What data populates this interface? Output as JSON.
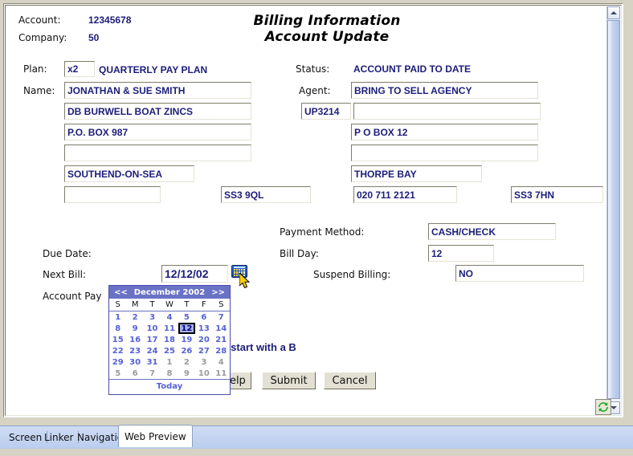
{
  "header": {
    "account_label": "Account:",
    "account_value": "12345678",
    "company_label": "Company:",
    "company_value": "50",
    "title_line1": "Billing Information",
    "title_line2": "Account Update"
  },
  "form": {
    "plan_label": "Plan:",
    "plan_code": "x2",
    "plan_description": "QUARTERLY PAY PLAN",
    "name_label": "Name:",
    "name_value": "JONATHAN & SUE SMITH",
    "left_address": [
      "DB BURWELL BOAT ZINCS",
      "P.O. BOX 987",
      "",
      "SOUTHEND-ON-SEA"
    ],
    "left_city_extra": "",
    "left_postcode": "SS3 9QL",
    "status_label": "Status:",
    "status_value": "ACCOUNT PAID TO DATE",
    "agent_label": "Agent:",
    "agent_value": "BRING TO SELL AGENCY",
    "agent_code": "UP3214",
    "right_address": [
      "",
      "P O BOX 12",
      "",
      "THORPE BAY"
    ],
    "right_phone": "020 711 2121",
    "right_postcode": "SS3 7HN",
    "payment_method_label": "Payment Method:",
    "payment_method_value": "CASH/CHECK",
    "due_date_label": "Due Date:",
    "bill_day_label": "Bill Day:",
    "bill_day_value": "12",
    "next_bill_label": "Next Bill:",
    "next_bill_value": "12/12/02",
    "suspend_billing_label": "Suspend Billing:",
    "suspend_billing_value": "NO",
    "account_pay_label": "Account Pay",
    "validation_message": "st start with a B"
  },
  "buttons": {
    "help": "Help",
    "submit": "Submit",
    "cancel": "Cancel"
  },
  "calendar": {
    "prev_label": "<<",
    "title": "December 2002",
    "next_label": ">>",
    "dow": [
      "S",
      "M",
      "T",
      "W",
      "T",
      "F",
      "S"
    ],
    "weeks": [
      [
        {
          "d": "1",
          "t": "in"
        },
        {
          "d": "2",
          "t": "in"
        },
        {
          "d": "3",
          "t": "in"
        },
        {
          "d": "4",
          "t": "in"
        },
        {
          "d": "5",
          "t": "in"
        },
        {
          "d": "6",
          "t": "in"
        },
        {
          "d": "7",
          "t": "in"
        }
      ],
      [
        {
          "d": "8",
          "t": "in"
        },
        {
          "d": "9",
          "t": "in"
        },
        {
          "d": "10",
          "t": "in"
        },
        {
          "d": "11",
          "t": "in"
        },
        {
          "d": "12",
          "t": "sel"
        },
        {
          "d": "13",
          "t": "in"
        },
        {
          "d": "14",
          "t": "in"
        }
      ],
      [
        {
          "d": "15",
          "t": "in"
        },
        {
          "d": "16",
          "t": "in"
        },
        {
          "d": "17",
          "t": "in"
        },
        {
          "d": "18",
          "t": "in"
        },
        {
          "d": "19",
          "t": "in"
        },
        {
          "d": "20",
          "t": "in"
        },
        {
          "d": "21",
          "t": "in"
        }
      ],
      [
        {
          "d": "22",
          "t": "in"
        },
        {
          "d": "23",
          "t": "in"
        },
        {
          "d": "24",
          "t": "in"
        },
        {
          "d": "25",
          "t": "in"
        },
        {
          "d": "26",
          "t": "in"
        },
        {
          "d": "27",
          "t": "in"
        },
        {
          "d": "28",
          "t": "in"
        }
      ],
      [
        {
          "d": "29",
          "t": "in"
        },
        {
          "d": "30",
          "t": "in"
        },
        {
          "d": "31",
          "t": "in"
        },
        {
          "d": "1",
          "t": "out"
        },
        {
          "d": "2",
          "t": "out"
        },
        {
          "d": "3",
          "t": "out"
        },
        {
          "d": "4",
          "t": "out"
        }
      ],
      [
        {
          "d": "5",
          "t": "out"
        },
        {
          "d": "6",
          "t": "out"
        },
        {
          "d": "7",
          "t": "out"
        },
        {
          "d": "8",
          "t": "out"
        },
        {
          "d": "9",
          "t": "out"
        },
        {
          "d": "10",
          "t": "out"
        },
        {
          "d": "11",
          "t": "out"
        }
      ]
    ],
    "today_label": "Today",
    "header_color": "#6a72c6",
    "selected_day": "12"
  },
  "tabs": [
    {
      "label": "Screen",
      "active": false
    },
    {
      "label": "Linker",
      "active": false
    },
    {
      "label": "Navigation",
      "active": false
    },
    {
      "label": "Web Preview",
      "active": true
    }
  ],
  "icons": {
    "calendar_picker": "calendar-icon",
    "refresh": "refresh-icon",
    "scroll_up": "scroll-up-arrow",
    "scroll_down": "scroll-down-arrow"
  }
}
